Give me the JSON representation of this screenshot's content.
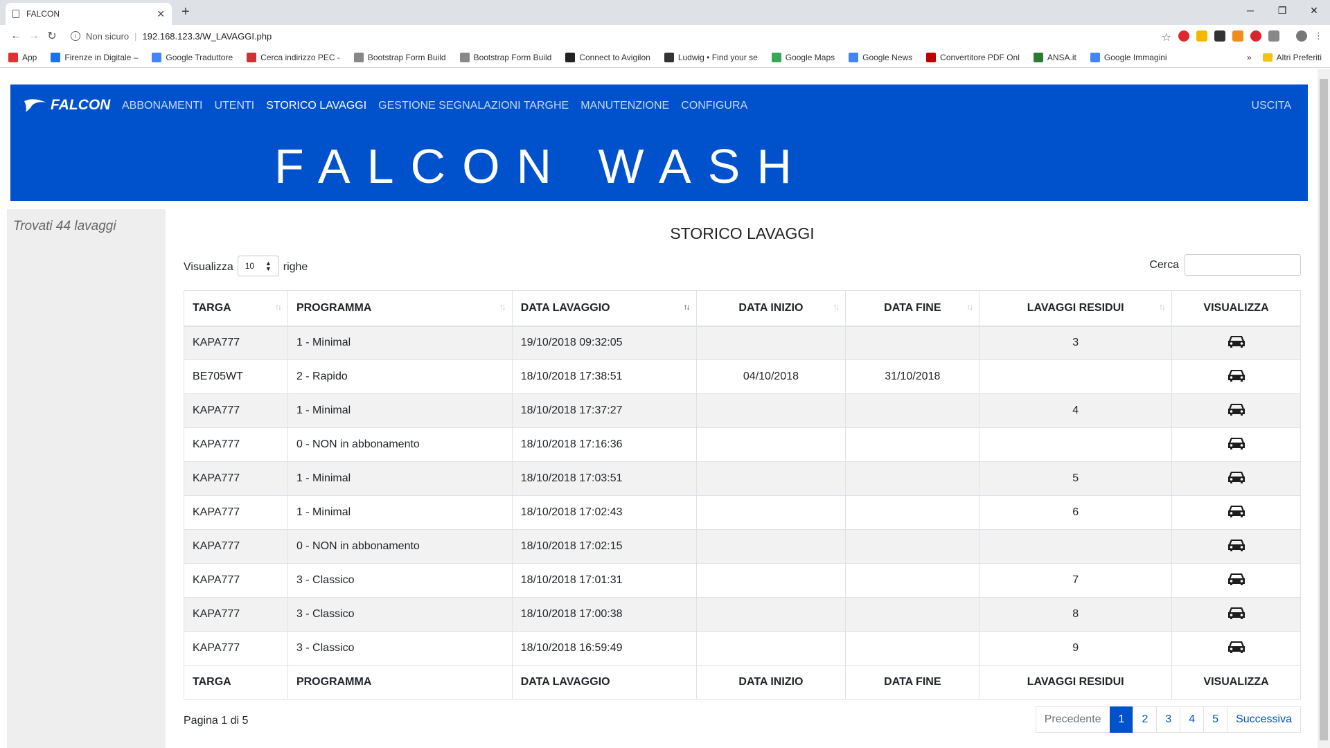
{
  "browser": {
    "tab_title": "FALCON",
    "security": "Non sicuro",
    "url": "192.168.123.3/W_LAVAGGI.php",
    "bookmarks": [
      "App",
      "Firenze in Digitale –",
      "Google Traduttore",
      "Cerca indirizzo PEC -",
      "Bootstrap Form Build",
      "Bootstrap Form Build",
      "Connect to Avigilon",
      "Ludwig • Find your se",
      "Google Maps",
      "Google News",
      "Convertitore PDF Onl",
      "ANSA.it",
      "Google Immagini"
    ],
    "bookmarks_more": "»",
    "other_bookmarks": "Altri Preferiti"
  },
  "header": {
    "logo": "FALCON",
    "nav": [
      "ABBONAMENTI",
      "UTENTI",
      "STORICO LAVAGGI",
      "GESTIONE SEGNALAZIONI TARGHE",
      "MANUTENZIONE",
      "CONFIGURA"
    ],
    "active": "STORICO LAVAGGI",
    "logout": "USCITA",
    "brand": "FALCON WASH"
  },
  "sidebar": {
    "count_text": "Trovati 44 lavaggi"
  },
  "main": {
    "title": "STORICO LAVAGGI",
    "show_label": "Visualizza",
    "show_value": "10",
    "rows_label": "righe",
    "search_label": "Cerca",
    "columns": [
      "TARGA",
      "PROGRAMMA",
      "DATA LAVAGGIO",
      "DATA INIZIO",
      "DATA FINE",
      "LAVAGGI RESIDUI",
      "VISUALIZZA"
    ],
    "rows": [
      [
        "KAPA777",
        "1 - Minimal",
        "19/10/2018 09:32:05",
        "",
        "",
        "3"
      ],
      [
        "BE705WT",
        "2 - Rapido",
        "18/10/2018 17:38:51",
        "04/10/2018",
        "31/10/2018",
        ""
      ],
      [
        "KAPA777",
        "1 - Minimal",
        "18/10/2018 17:37:27",
        "",
        "",
        "4"
      ],
      [
        "KAPA777",
        "0 - NON in abbonamento",
        "18/10/2018 17:16:36",
        "",
        "",
        ""
      ],
      [
        "KAPA777",
        "1 - Minimal",
        "18/10/2018 17:03:51",
        "",
        "",
        "5"
      ],
      [
        "KAPA777",
        "1 - Minimal",
        "18/10/2018 17:02:43",
        "",
        "",
        "6"
      ],
      [
        "KAPA777",
        "0 - NON in abbonamento",
        "18/10/2018 17:02:15",
        "",
        "",
        ""
      ],
      [
        "KAPA777",
        "3 - Classico",
        "18/10/2018 17:01:31",
        "",
        "",
        "7"
      ],
      [
        "KAPA777",
        "3 - Classico",
        "18/10/2018 17:00:38",
        "",
        "",
        "8"
      ],
      [
        "KAPA777",
        "3 - Classico",
        "18/10/2018 16:59:49",
        "",
        "",
        "9"
      ]
    ],
    "page_info": "Pagina 1 di 5",
    "pager": [
      "Precedente",
      "1",
      "2",
      "3",
      "4",
      "5",
      "Successiva"
    ],
    "current_page": "1"
  },
  "colors": {
    "brand_blue": "#0052cc"
  }
}
